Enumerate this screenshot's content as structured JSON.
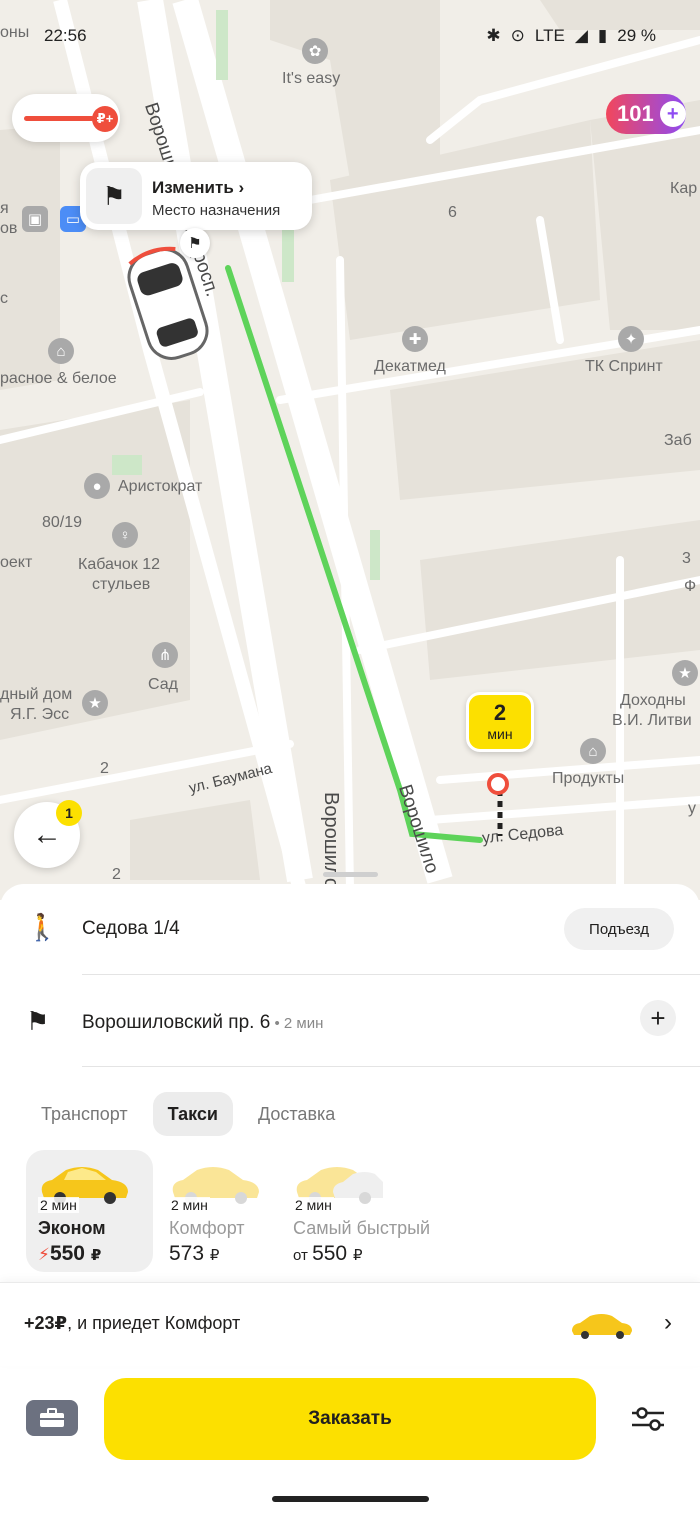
{
  "status_bar": {
    "time": "22:56",
    "network": "LTE",
    "battery": "29 %"
  },
  "map": {
    "labels": {
      "its_easy": "It's easy",
      "vorosh_top": "Ворошиловский просп.",
      "vorosh_bottom": "Ворошиловский",
      "vorosh_far": "Ворошило",
      "baumana": "ул. Баумана",
      "sedova_street": "ул. Седова",
      "dekatmed": "Декатмед",
      "tk_sprint": "ТК Спринт",
      "aristokrat": "Аристократ",
      "kabachok_1": "Кабачок 12",
      "kabachok_2": "стульев",
      "sad": "Сад",
      "produkty": "Продукты",
      "dokhodny_1": "Доходны",
      "dokhodny_2": "В.И. Литви",
      "krasnoe": "расное & белое",
      "num_80_19": "80/19",
      "num_6": "6",
      "num_3": "3",
      "proekt": "оект",
      "dom_1": "дный дом",
      "dom_2": "Я.Г. Эсс",
      "edge_ony": "оны",
      "edge_ya": "я",
      "edge_ov": "ов",
      "edge_s": "с",
      "edge_kar": "Кар",
      "edge_zab": "Заб",
      "edge_f": "Ф",
      "edge_u": "у",
      "house_2a": "2",
      "house_2b": "2"
    },
    "price_chip_icon": "₽+",
    "plus_points": "101",
    "plus_icon": "+",
    "destination_card": {
      "title": "Изменить ›",
      "subtitle": "Место назначения"
    },
    "eta_bubble": {
      "value": "2",
      "unit": "мин"
    },
    "back_badge": "1",
    "route_color": "#5ed35a"
  },
  "trip": {
    "pickup": {
      "address": "Седова 1/4",
      "entrance_button": "Подъезд"
    },
    "destination": {
      "address": "Ворошиловский пр. 6",
      "eta": " • 2 мин"
    }
  },
  "tabs": [
    "Транспорт",
    "Такси",
    "Доставка"
  ],
  "active_tab": "Такси",
  "tariffs": [
    {
      "eta": "2 мин",
      "name": "Эконом",
      "price": "550",
      "prefix": "⚡",
      "currency": "₽",
      "selected": true
    },
    {
      "eta": "2 мин",
      "name": "Комфорт",
      "price": "573",
      "prefix": "",
      "currency": "₽",
      "selected": false
    },
    {
      "eta": "2 мин",
      "name": "Самый быстрый",
      "price": "550",
      "prefix": "от ",
      "currency": "₽",
      "selected": false
    }
  ],
  "upsell": {
    "amount": "+23₽",
    "text": ", и приедет Комфорт"
  },
  "order_button": "Заказать",
  "colors": {
    "accent": "#fce000",
    "route": "#5ed35a",
    "pin": "#ef4e3c"
  }
}
